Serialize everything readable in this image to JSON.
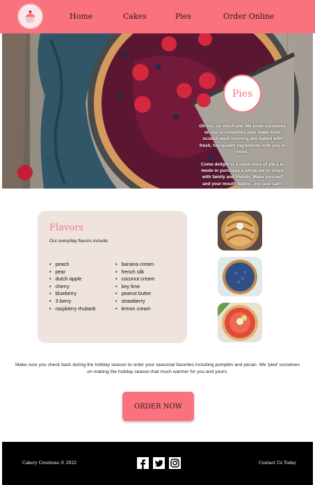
{
  "brand": {
    "logo_icon": "cupcake-icon",
    "colors": {
      "accent": "#f9727e",
      "card": "#efe3dd",
      "footer": "#000000"
    }
  },
  "nav": {
    "items": [
      {
        "label": "Home"
      },
      {
        "label": "Cakes"
      },
      {
        "label": "Pies"
      },
      {
        "label": "Order Online"
      }
    ]
  },
  "hero": {
    "title": "Pies",
    "paragraphs": [
      "Oh my...so much pie! We pride ourselves on our scrumptious pies made from scratch each morning and baked with fresh, top-quality ingredients with you in mind.",
      "Come delight in a warm slice of pie a la mode or purchase a whole pie to share with family and friends. Make yourself and your mouth happy...you just can't beat down-home goodness and flavor...Yum!"
    ]
  },
  "flavors": {
    "title": "Flavors",
    "intro": "Our everyday flavors include:",
    "left": [
      "peach",
      "pear",
      "dutch apple",
      "cherry",
      "blueberry",
      "3 berry",
      "raspberry rhubarb"
    ],
    "right": [
      "banana cream",
      "french silk",
      "coconut cream",
      "key lime",
      "peanut butter",
      "strawberry",
      "lemon cream"
    ]
  },
  "holiday": {
    "text": "Make sure you check back during the holiday season to order your seasonal favorites including pumpkin and pecan. We 'pied' ourselves on making the holiday season that much warmer for you and yours."
  },
  "order": {
    "label": "ORDER NOW"
  },
  "footer": {
    "copyright": "Cakery Creations © 2022",
    "contact": "Contact Us Today",
    "social": [
      "facebook-icon",
      "twitter-icon",
      "instagram-icon"
    ]
  }
}
